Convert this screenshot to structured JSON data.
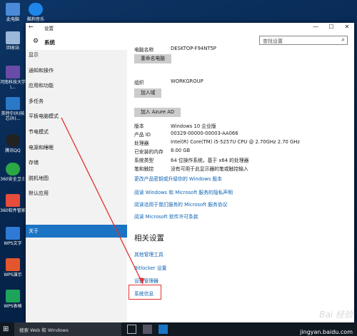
{
  "desktop": {
    "icons": [
      {
        "label": "此电脑"
      },
      {
        "label": "酷狗音乐"
      },
      {
        "label": "回收站"
      },
      {
        "label": "河南科技大学\\..."
      },
      {
        "label": "英特尔(R)核芯(R)..."
      },
      {
        "label": "腾讯QQ"
      },
      {
        "label": "360安全卫士"
      },
      {
        "label": "360软件管家"
      },
      {
        "label": "WPS文字"
      },
      {
        "label": "WPS演示"
      },
      {
        "label": "WPS表格"
      }
    ]
  },
  "window": {
    "title": "设置",
    "section": "系统",
    "search_placeholder": "查找设置",
    "controls": {
      "minimize": "—",
      "maximize": "☐",
      "close": "✕"
    }
  },
  "sidebar": {
    "items": [
      {
        "label": "显示"
      },
      {
        "label": "通知和操作"
      },
      {
        "label": "应用和功能"
      },
      {
        "label": "多任务"
      },
      {
        "label": "平板电脑模式"
      },
      {
        "label": "节电模式"
      },
      {
        "label": "电源和睡眠"
      },
      {
        "label": "存储"
      },
      {
        "label": "脱机地图"
      },
      {
        "label": "默认应用"
      },
      {
        "label": "关于"
      }
    ],
    "active_index": 10
  },
  "about": {
    "pc_name_label": "电脑名称",
    "pc_name_value": "DESKTOP-F94NT5P",
    "rename_button": "重命名电脑",
    "org_label": "组织",
    "org_value": "WORKGROUP",
    "join_domain_button": "加入域",
    "join_azure_button": "加入 Azure AD",
    "specs": [
      {
        "label": "版本",
        "value": "Windows 10 企业版"
      },
      {
        "label": "产品 ID",
        "value": "00329-00000-00003-AA066"
      },
      {
        "label": "处理器",
        "value": "Intel(R) Core(TM) i5-5257U CPU @ 2.70GHz   2.70 GHz"
      },
      {
        "label": "已安装的内存",
        "value": "8.00 GB"
      },
      {
        "label": "系统类型",
        "value": "64 位操作系统，基于 x64 的处理器"
      },
      {
        "label": "笔和触控",
        "value": "没有可用于此显示器的笔或触控输入"
      }
    ],
    "links": [
      {
        "text": "更改产品密钥或升级你的 Windows 版本"
      },
      {
        "text": "阅读 Windows 和 Microsoft 服务的隐私声明"
      },
      {
        "text": "阅读适用于我们服务的 Microsoft 服务协议"
      },
      {
        "text": "阅读 Microsoft 软件许可条款"
      }
    ],
    "related_heading": "相关设置",
    "related_links": [
      {
        "text": "其他管理工具"
      },
      {
        "text": "Bitlocker 设置"
      },
      {
        "text": "设备管理器"
      },
      {
        "text": "系统信息"
      }
    ]
  },
  "taskbar": {
    "search_text": "搜索 Web 和 Windows"
  },
  "watermark": {
    "text": "Bai 经验",
    "url": "jingyan.baidu.com"
  },
  "colors": {
    "accent": "#1b73c4",
    "link": "#0d62b3",
    "highlight": "#e23030"
  }
}
